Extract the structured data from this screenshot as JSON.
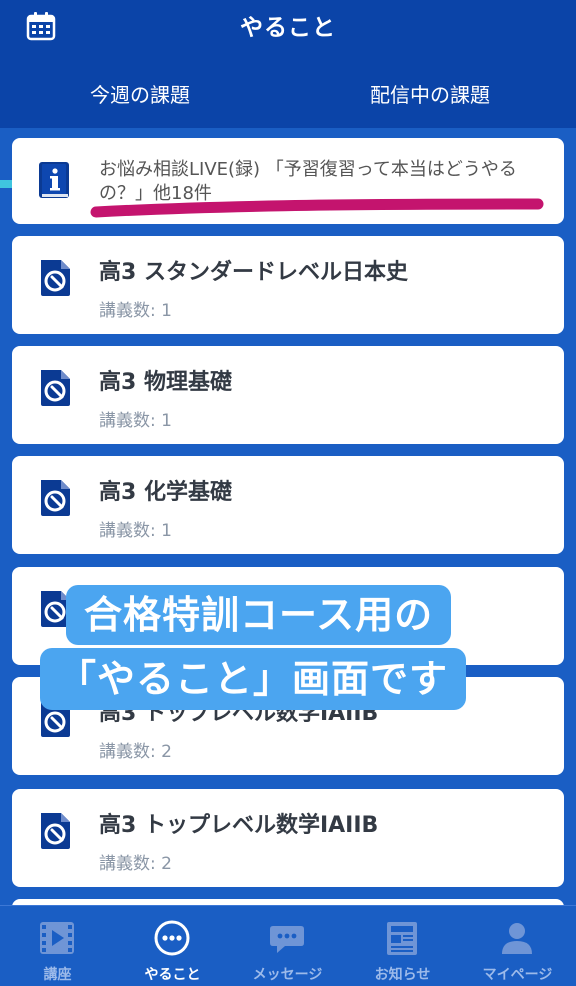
{
  "header": {
    "title": "やること",
    "calendar_icon": "calendar-icon"
  },
  "tabs": [
    {
      "label": "今週の課題",
      "active": true
    },
    {
      "label": "配信中の課題",
      "active": false
    }
  ],
  "info_card": {
    "icon": "info-book-icon",
    "text": "お悩み相談LIVE(録) 「予習復習って本当はどうやるの？」他18件"
  },
  "courses": [
    {
      "title": "高3 スタンダードレベル日本史",
      "meta": "講義数: 1"
    },
    {
      "title": "高3 物理基礎",
      "meta": "講義数: 1"
    },
    {
      "title": "高3 化学基礎",
      "meta": "講義数: 1"
    },
    {
      "title": "",
      "meta": ""
    },
    {
      "title": "高3 トップレベル数学IAIIB",
      "meta": "講義数: 2"
    },
    {
      "title": "高3 トップレベル数学IAIIB",
      "meta": "講義数: 2"
    }
  ],
  "overlay": {
    "line1": "合格特訓コース用の",
    "line2": "「やること」画面です"
  },
  "bottom_nav": [
    {
      "label": "講座",
      "icon": "video-icon",
      "active": false
    },
    {
      "label": "やること",
      "icon": "more-dots-icon",
      "active": true
    },
    {
      "label": "メッセージ",
      "icon": "chat-icon",
      "active": false
    },
    {
      "label": "お知らせ",
      "icon": "newspaper-icon",
      "active": false
    },
    {
      "label": "マイページ",
      "icon": "person-icon",
      "active": false
    }
  ],
  "colors": {
    "header_bg": "#0b44a8",
    "body_bg": "#1a5ec4",
    "tab_indicator": "#3fc5df",
    "overlay_bg": "#4ba5f0",
    "underline_annotation": "#c4146e"
  }
}
